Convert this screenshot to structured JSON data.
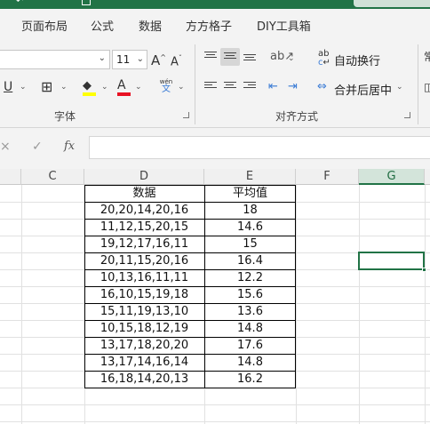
{
  "menu": {
    "tabs": [
      "页面布局",
      "公式",
      "数据",
      "方方格子",
      "DIY工具箱"
    ]
  },
  "ribbon": {
    "font_size": "11",
    "font_group_label": "字体",
    "align_group_label": "对齐方式",
    "wrap_text_label": "自动换行",
    "merge_center_label": "合并后居中",
    "wen_label": "wén",
    "wen_char": "文",
    "grow_font": "A",
    "shrink_font": "A",
    "underline": "U",
    "font_color_letter": "A",
    "ab_label": "ab",
    "c_label": "c",
    "right_cut": "常"
  },
  "formula_bar": {
    "fx_label": "fx",
    "cancel_symbol": "×",
    "confirm_symbol": "✓",
    "value": ""
  },
  "columns": [
    "C",
    "D",
    "E",
    "F",
    "G"
  ],
  "active_column": "G",
  "table": {
    "headers": [
      "数据",
      "平均值"
    ],
    "rows": [
      [
        "20,20,14,20,16",
        "18"
      ],
      [
        "11,12,15,20,15",
        "14.6"
      ],
      [
        "19,12,17,16,11",
        "15"
      ],
      [
        "20,11,15,20,16",
        "16.4"
      ],
      [
        "10,13,16,11,11",
        "12.2"
      ],
      [
        "16,10,15,19,18",
        "15.6"
      ],
      [
        "15,11,19,13,10",
        "13.6"
      ],
      [
        "10,15,18,12,19",
        "14.8"
      ],
      [
        "13,17,18,20,20",
        "17.6"
      ],
      [
        "13,17,14,16,14",
        "14.8"
      ],
      [
        "16,18,14,20,13",
        "16.2"
      ]
    ]
  },
  "colors": {
    "accent": "#217346",
    "font_color_bar": "#e81123",
    "highlight_bar": "#ffff00"
  }
}
